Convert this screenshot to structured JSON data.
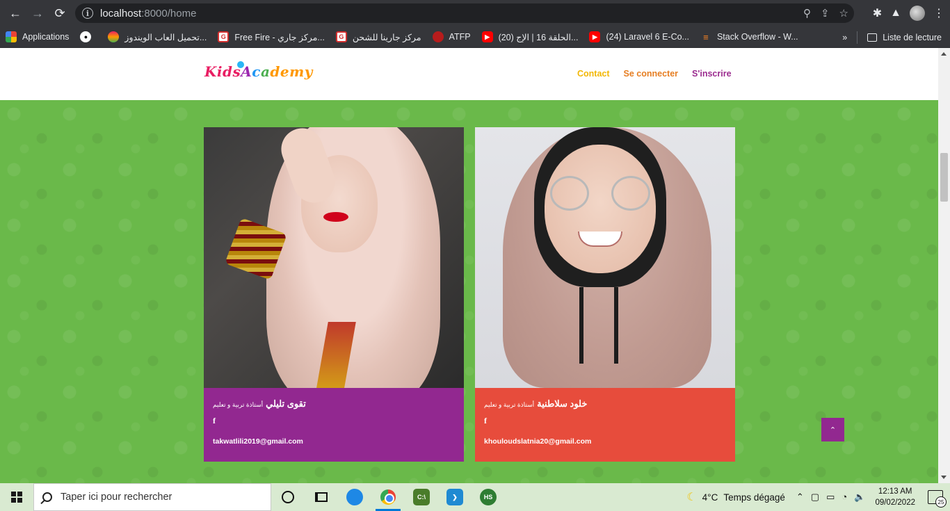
{
  "browser": {
    "url_host": "localhost",
    "url_rest": ":8000/home",
    "bookmarks": [
      {
        "label": "Applications",
        "icon": "apps-grid-icon"
      },
      {
        "label": "",
        "icon": "github-icon"
      },
      {
        "label": "تحميل العاب الويندوز...",
        "icon": "rainbow-icon"
      },
      {
        "label": "Free Fire - مركز جاري...",
        "icon": "freefire-icon"
      },
      {
        "label": "مركز جارينا للشحن",
        "icon": "garena-icon"
      },
      {
        "label": "ATFP",
        "icon": "atfp-icon"
      },
      {
        "label": "(20) الحلقة 16 | الإج...",
        "icon": "youtube-icon"
      },
      {
        "label": "(24) Laravel 6 E-Co...",
        "icon": "youtube-icon"
      },
      {
        "label": "Stack Overflow - W...",
        "icon": "stackoverflow-icon"
      }
    ],
    "more_label": "»",
    "reading_list": "Liste de lecture"
  },
  "site": {
    "logo_parts": [
      "Kids",
      "A",
      "c",
      "a",
      "demy"
    ],
    "nav": {
      "contact": "Contact",
      "login": "Se connecter",
      "signup": "S'inscrire"
    },
    "colors": {
      "green": "#6ab94a",
      "purple": "#922890",
      "red": "#e74c3c",
      "yellow": "#f2b705",
      "orange": "#e67e22"
    },
    "teachers": [
      {
        "name": "تقوى تليلي",
        "role": "أستاذة تربية و تعليم",
        "social": "f",
        "email": "takwatlili2019@gmail.com",
        "card_color": "#922890"
      },
      {
        "name": "خلود سلاطنية",
        "role": "أستاذة تربية و تعليم",
        "social": "f",
        "email": "khouloudslatnia20@gmail.com",
        "card_color": "#e74c3c"
      }
    ],
    "to_top": "⌃"
  },
  "taskbar": {
    "search_placeholder": "Taper ici pour rechercher",
    "weather_temp": "4°C",
    "weather_text": "Temps dégagé",
    "time": "12:13 AM",
    "date": "09/02/2022",
    "notifications": "25"
  }
}
